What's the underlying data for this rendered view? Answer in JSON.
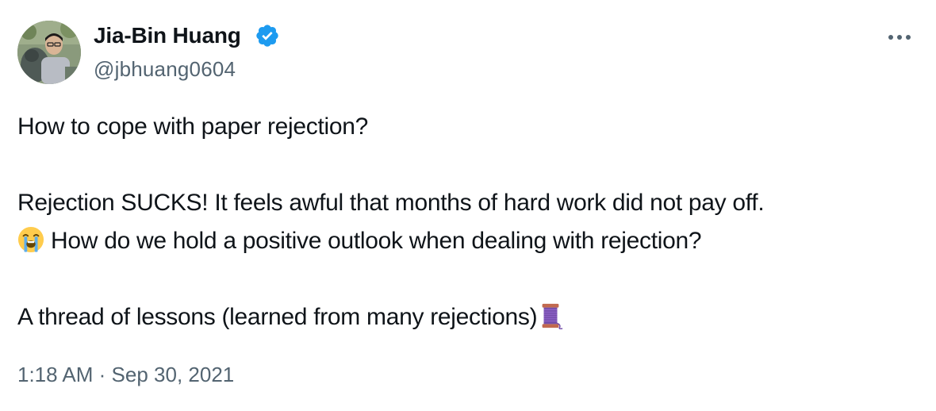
{
  "author": {
    "display_name": "Jia-Bin Huang",
    "handle": "@jbhuang0604",
    "verified": true,
    "avatar_icon": "profile-photo"
  },
  "menu": {
    "more_icon": "more-horizontal-icon"
  },
  "tweet": {
    "line1": "How to cope with paper rejection?",
    "line2": "Rejection SUCKS! It feels awful that months of hard work did not pay off.",
    "line3": "How do we hold a positive outlook when dealing with rejection?",
    "line3_emoji": "loudly-crying-face",
    "line4": "A thread of lessons (learned from many rejections)",
    "line4_emoji": "thread-spool"
  },
  "meta": {
    "time": "1:18 AM",
    "separator": "·",
    "date": "Sep 30, 2021"
  },
  "colors": {
    "text": "#0f1419",
    "secondary": "#536471",
    "verified": "#1d9bf0"
  }
}
